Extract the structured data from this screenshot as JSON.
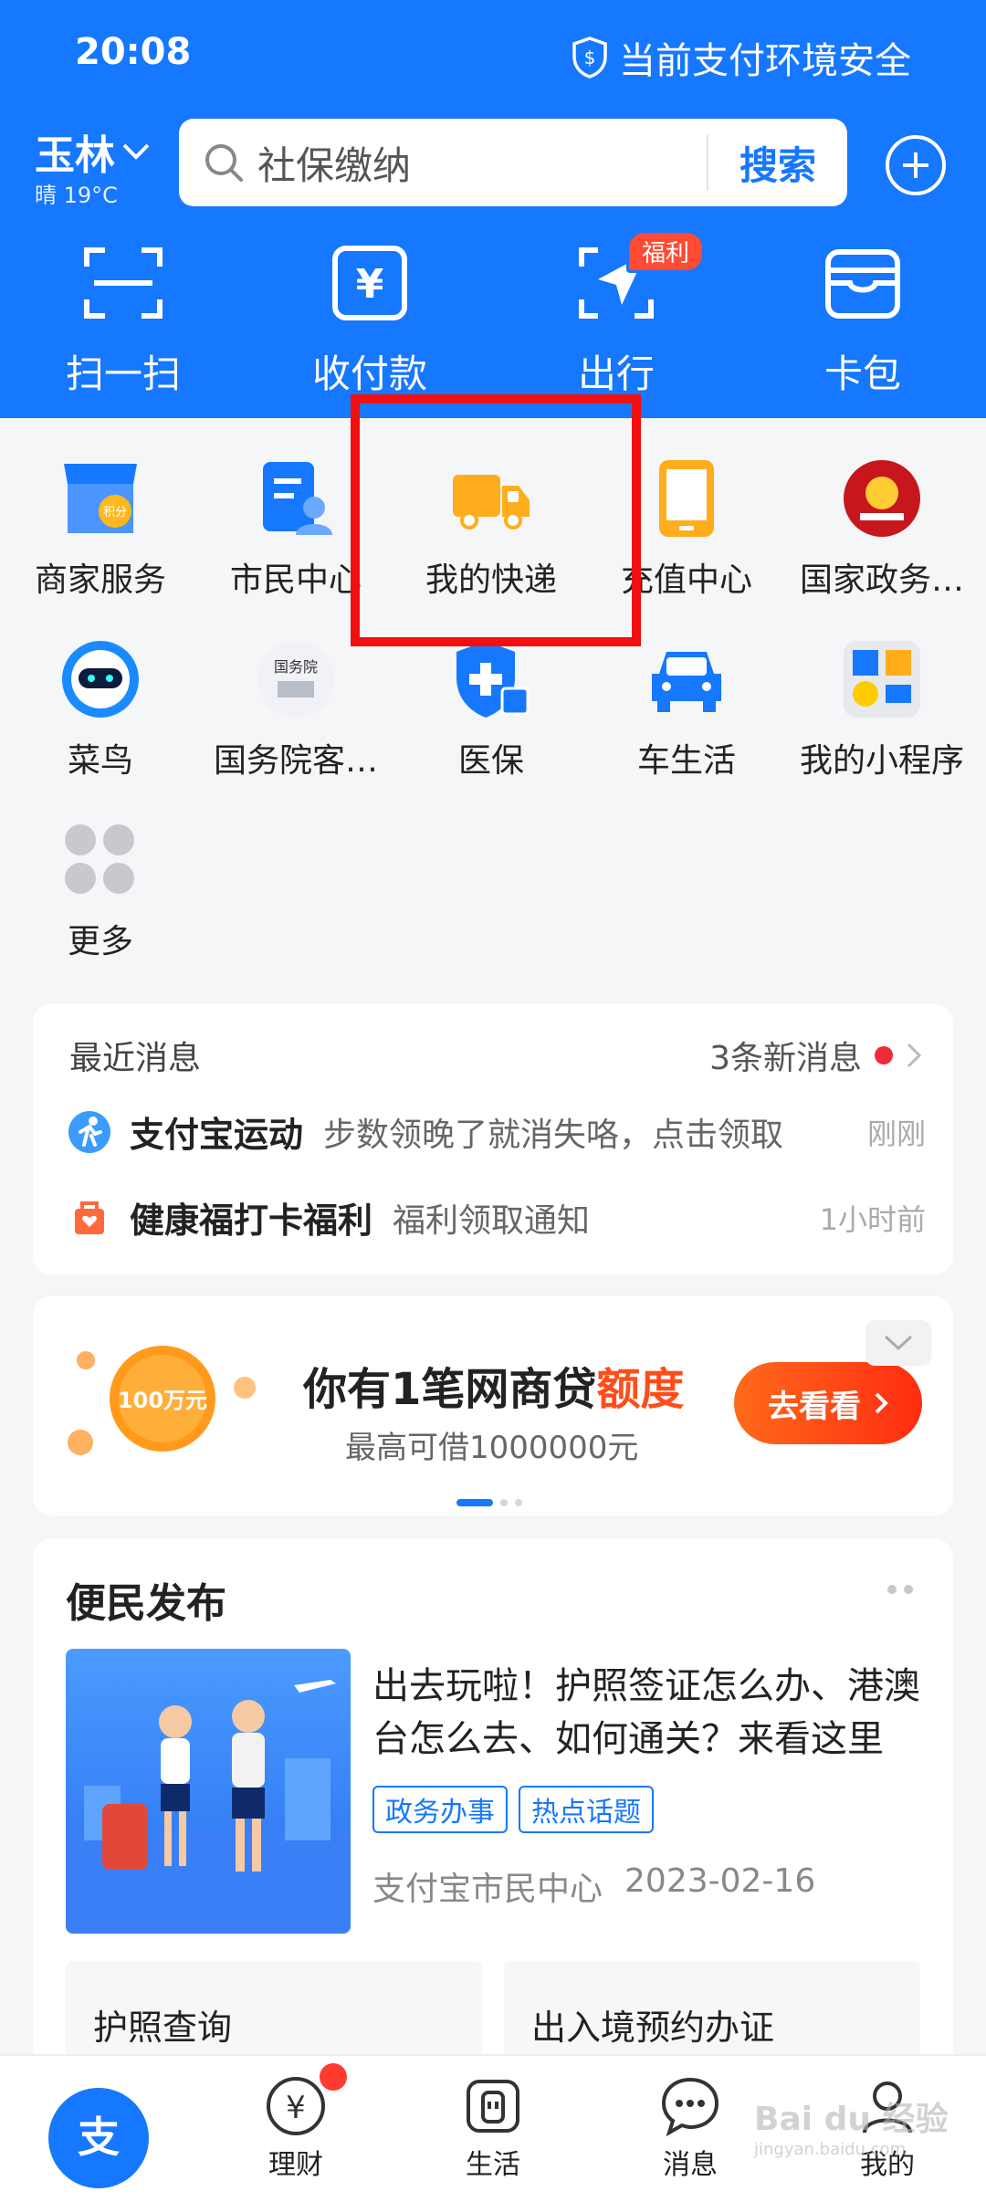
{
  "status_bar": {
    "time": "20:08",
    "safety": "当前支付环境安全"
  },
  "header": {
    "city": "玉林",
    "weather": "晴 19°C",
    "search_placeholder": "社保缴纳",
    "search_button": "搜索",
    "actions": [
      {
        "label": "扫一扫",
        "icon": "scan-icon"
      },
      {
        "label": "收付款",
        "icon": "yuan-icon"
      },
      {
        "label": "出行",
        "icon": "travel-icon"
      },
      {
        "label": "卡包",
        "icon": "wallet-icon"
      }
    ],
    "travel_badge": "福利"
  },
  "services": {
    "row1": [
      {
        "label": "商家服务",
        "badge": "积分"
      },
      {
        "label": "市民中心"
      },
      {
        "label": "我的快递"
      },
      {
        "label": "充值中心"
      },
      {
        "label": "国家政务…"
      }
    ],
    "row2": [
      {
        "label": "菜鸟"
      },
      {
        "label": "国务院客…",
        "icon_text": "国务院"
      },
      {
        "label": "医保"
      },
      {
        "label": "车生活"
      },
      {
        "label": "我的小程序"
      }
    ],
    "row3": [
      {
        "label": "更多"
      }
    ]
  },
  "messages": {
    "title": "最近消息",
    "new_count": "3条新消息",
    "items": [
      {
        "title": "支付宝运动",
        "desc": "步数领晚了就消失咯，点击领取",
        "time": "刚刚"
      },
      {
        "title": "健康福打卡福利",
        "desc": "福利领取通知",
        "time": "1小时前"
      }
    ]
  },
  "loan": {
    "coin_text": "100万元",
    "title_main": "你有1笔网商贷",
    "title_highlight": "额度",
    "subtitle": "最高可借1000000元",
    "button": "去看看"
  },
  "convenience": {
    "title": "便民发布",
    "headline": "出去玩啦！护照签证怎么办、港澳台怎么去、如何通关？来看这里",
    "tags": [
      "政务办事",
      "热点话题"
    ],
    "source": "支付宝市民中心",
    "date": "2023-02-16",
    "sub_items": [
      "护照查询",
      "出入境预约办证"
    ]
  },
  "tabbar": [
    {
      "label": "",
      "icon": "alipay-home-icon"
    },
    {
      "label": "理财",
      "icon": "finance-icon"
    },
    {
      "label": "生活",
      "icon": "life-icon"
    },
    {
      "label": "消息",
      "icon": "message-icon"
    },
    {
      "label": "我的",
      "icon": "profile-icon"
    }
  ],
  "watermark": {
    "main": "Bai du 经验",
    "sub": "jingyan.baidu.com"
  },
  "colors": {
    "brand": "#1677ff",
    "highlight_box": "#f20f0f",
    "loan_accent": "#ff4d1a"
  }
}
